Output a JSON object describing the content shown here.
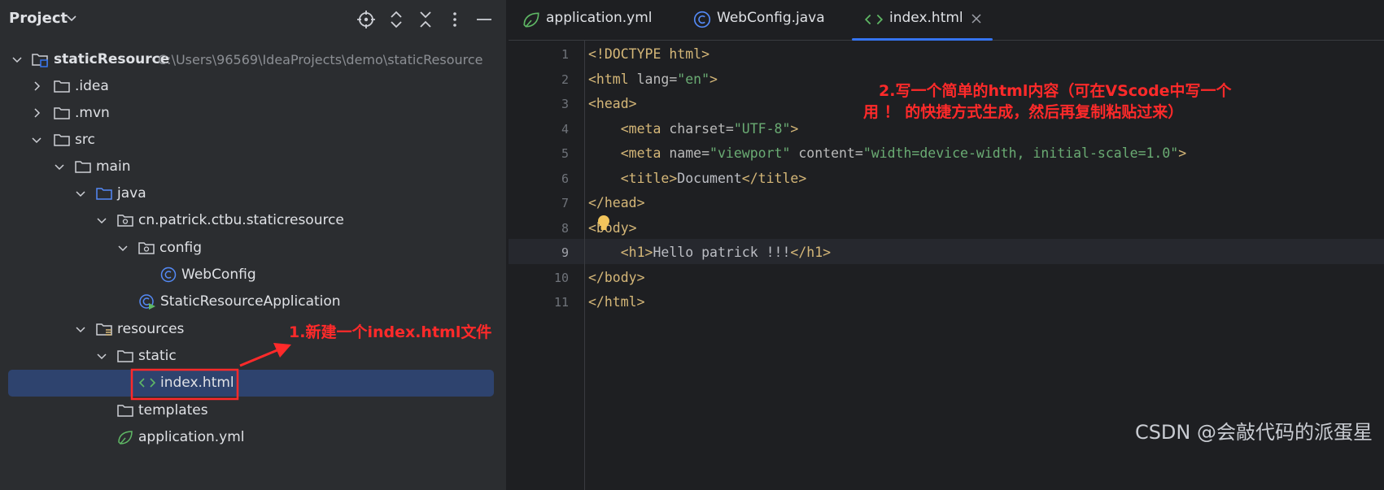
{
  "project_panel": {
    "title": "Project",
    "header_icons": [
      "locate-icon",
      "expand-all-icon",
      "collapse-all-icon",
      "more-options-icon",
      "minimize-icon"
    ],
    "tree": [
      {
        "label": "staticResource",
        "path": "C:\\Users\\96569\\IdeaProjects\\demo\\staticResource",
        "icon": "module-folder-icon",
        "expanded": true
      },
      {
        "label": ".idea",
        "icon": "folder-icon",
        "expanded": false
      },
      {
        "label": ".mvn",
        "icon": "folder-icon",
        "expanded": false
      },
      {
        "label": "src",
        "icon": "folder-icon",
        "expanded": true
      },
      {
        "label": "main",
        "icon": "folder-icon",
        "expanded": true
      },
      {
        "label": "java",
        "icon": "source-folder-icon",
        "expanded": true
      },
      {
        "label": "cn.patrick.ctbu.staticresource",
        "icon": "package-icon",
        "expanded": true
      },
      {
        "label": "config",
        "icon": "package-icon",
        "expanded": true
      },
      {
        "label": "WebConfig",
        "icon": "class-icon"
      },
      {
        "label": "StaticResourceApplication",
        "icon": "spring-boot-app-icon"
      },
      {
        "label": "resources",
        "icon": "resources-folder-icon",
        "expanded": true
      },
      {
        "label": "static",
        "icon": "folder-icon",
        "expanded": true
      },
      {
        "label": "index.html",
        "icon": "html-file-icon",
        "selected": true
      },
      {
        "label": "templates",
        "icon": "folder-icon"
      },
      {
        "label": "application.yml",
        "icon": "yaml-spring-icon"
      }
    ]
  },
  "editor": {
    "tabs": [
      {
        "label": "application.yml",
        "icon": "yaml-spring-icon",
        "active": false
      },
      {
        "label": "WebConfig.java",
        "icon": "class-icon",
        "active": false
      },
      {
        "label": "index.html",
        "icon": "html-file-icon",
        "active": true
      }
    ],
    "line_numbers": [
      "1",
      "2",
      "3",
      "4",
      "5",
      "6",
      "7",
      "8",
      "9",
      "10",
      "11"
    ],
    "current_line": 9,
    "code": {
      "l1": {
        "tag": "<!DOCTYPE html>"
      },
      "l2": {
        "open": "<html ",
        "attr": "lang",
        "eq": "=",
        "val": "\"en\"",
        "close": ">"
      },
      "l3": {
        "tag": "<head>"
      },
      "l4": {
        "indent": "    ",
        "open": "<meta ",
        "attr": "charset",
        "eq": "=",
        "val": "\"UTF-8\"",
        "close": ">"
      },
      "l5": {
        "indent": "    ",
        "open": "<meta ",
        "attr1": "name",
        "eq1": "=",
        "val1": "\"viewport\"",
        "sp": " ",
        "attr2": "content",
        "eq2": "=",
        "val2": "\"width=device-width, initial-scale=1.0\"",
        "close": ">"
      },
      "l6": {
        "indent": "    ",
        "open": "<title>",
        "text": "Document",
        "close": "</title>"
      },
      "l7": {
        "tag": "</head>"
      },
      "l8": {
        "tag": "<body>"
      },
      "l9": {
        "indent": "    ",
        "open": "<h1>",
        "text": "Hello patrick !!!",
        "close": "</h1>"
      },
      "l10": {
        "tag": "</body>"
      },
      "l11": {
        "tag": "</html>"
      }
    }
  },
  "annotations": {
    "step1": "1.新建一个index.html文件",
    "step2_line1": "2.写一个简单的html内容（可在VScode中写一个",
    "step2_line2": "用 ！ 的快捷方式生成，然后再复制粘贴过来）"
  },
  "watermark": "CSDN @会敲代码的派蛋星",
  "colors": {
    "annotation": "#ff2a2a",
    "selection": "#2e436e",
    "tab_underline": "#3574f0",
    "tag": "#d5b778",
    "string": "#6aab73"
  }
}
